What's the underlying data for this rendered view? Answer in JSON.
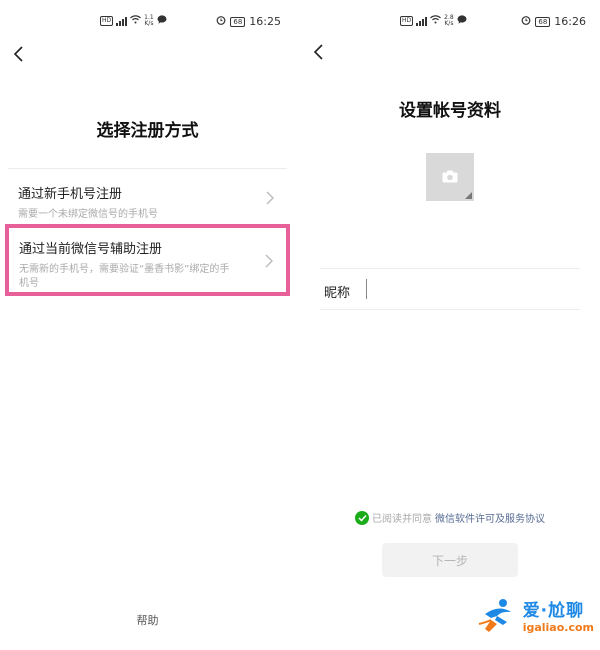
{
  "left_screen": {
    "status_bar": {
      "net_speed_value": "1.1",
      "net_speed_unit": "K/s",
      "battery": "68",
      "time": "16:25"
    },
    "title": "选择注册方式",
    "options": [
      {
        "title": "通过新手机号注册",
        "desc": "需要一个未绑定微信号的手机号"
      },
      {
        "title": "通过当前微信号辅助注册",
        "desc": "无需新的手机号，需要验证“墨香书影”绑定的手机号"
      }
    ],
    "help": "帮助"
  },
  "right_screen": {
    "status_bar": {
      "net_speed_value": "2.8",
      "net_speed_unit": "K/s",
      "battery": "68",
      "time": "16:26"
    },
    "title": "设置帐号资料",
    "nickname_label": "昵称",
    "nickname_value": "",
    "agreement_prefix": "已阅读并同意",
    "agreement_link": "微信软件许可及服务协议",
    "next_button": "下一步"
  },
  "watermark": {
    "title": "爱·尬聊",
    "url": "igaliao.com"
  },
  "colors": {
    "highlight": "#e8609a",
    "check": "#1aad19",
    "link": "#576b95",
    "watermark_blue": "#1e88e5",
    "watermark_orange": "#f07a1a"
  },
  "icons": [
    "back-arrow-icon",
    "chevron-right-icon",
    "camera-icon",
    "checkmark-icon",
    "hd-icon",
    "signal-icon",
    "wifi-icon",
    "message-icon",
    "alarm-icon",
    "battery-icon"
  ]
}
